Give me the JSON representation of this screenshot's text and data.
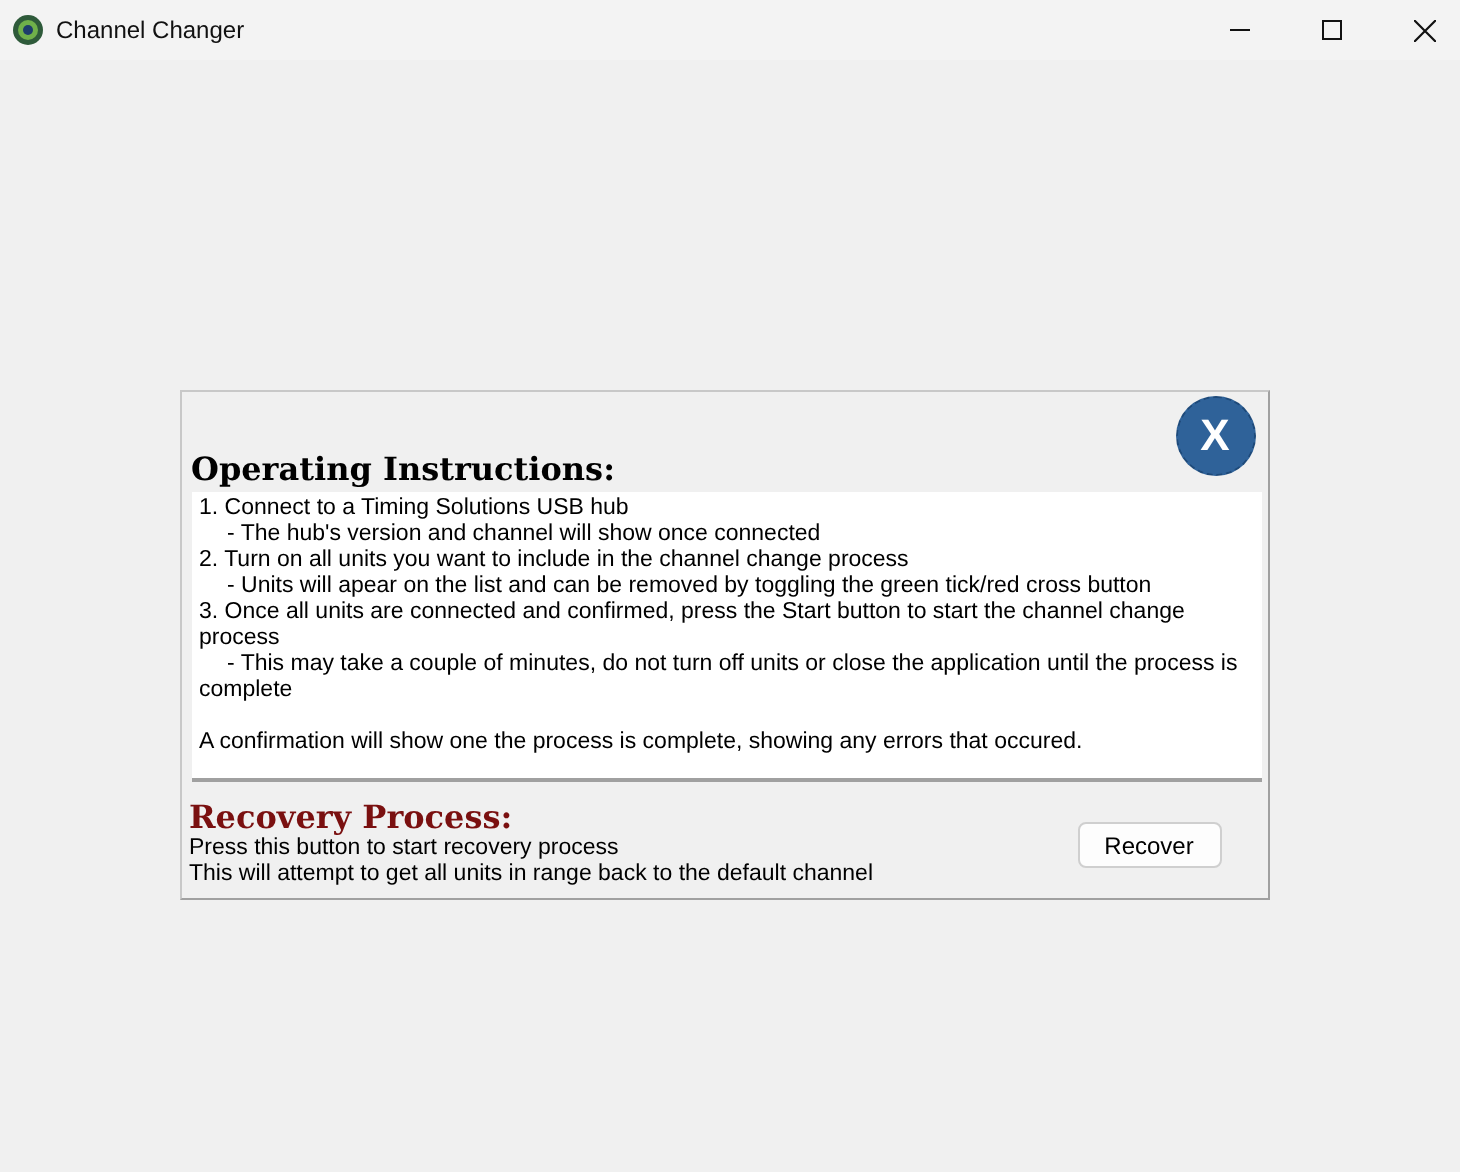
{
  "window": {
    "title": "Channel Changer"
  },
  "panel": {
    "heading": "Operating Instructions:",
    "close_label": "X",
    "instructions": [
      {
        "kind": "step",
        "text": "1. Connect to a Timing Solutions USB hub"
      },
      {
        "kind": "note",
        "text": "- The hub's version and channel will show once connected"
      },
      {
        "kind": "step",
        "text": "2. Turn on all units you want to include in the channel change process"
      },
      {
        "kind": "note",
        "text": "- Units will apear on the list and can be removed by toggling the green tick/red cross button"
      },
      {
        "kind": "step",
        "text": "3. Once all units are connected and confirmed, press the Start button to start the channel change process"
      },
      {
        "kind": "note",
        "text": "- This may take a couple of minutes, do not turn off units or close the application until the process is complete"
      },
      {
        "kind": "paragraph",
        "text": "A confirmation will show one the process is complete, showing any errors that occured."
      }
    ],
    "recovery": {
      "heading": "Recovery Process:",
      "lines": [
        "Press this button to start recovery process",
        "This will attempt to get all units in range back to the default channel"
      ],
      "button": "Recover"
    }
  }
}
